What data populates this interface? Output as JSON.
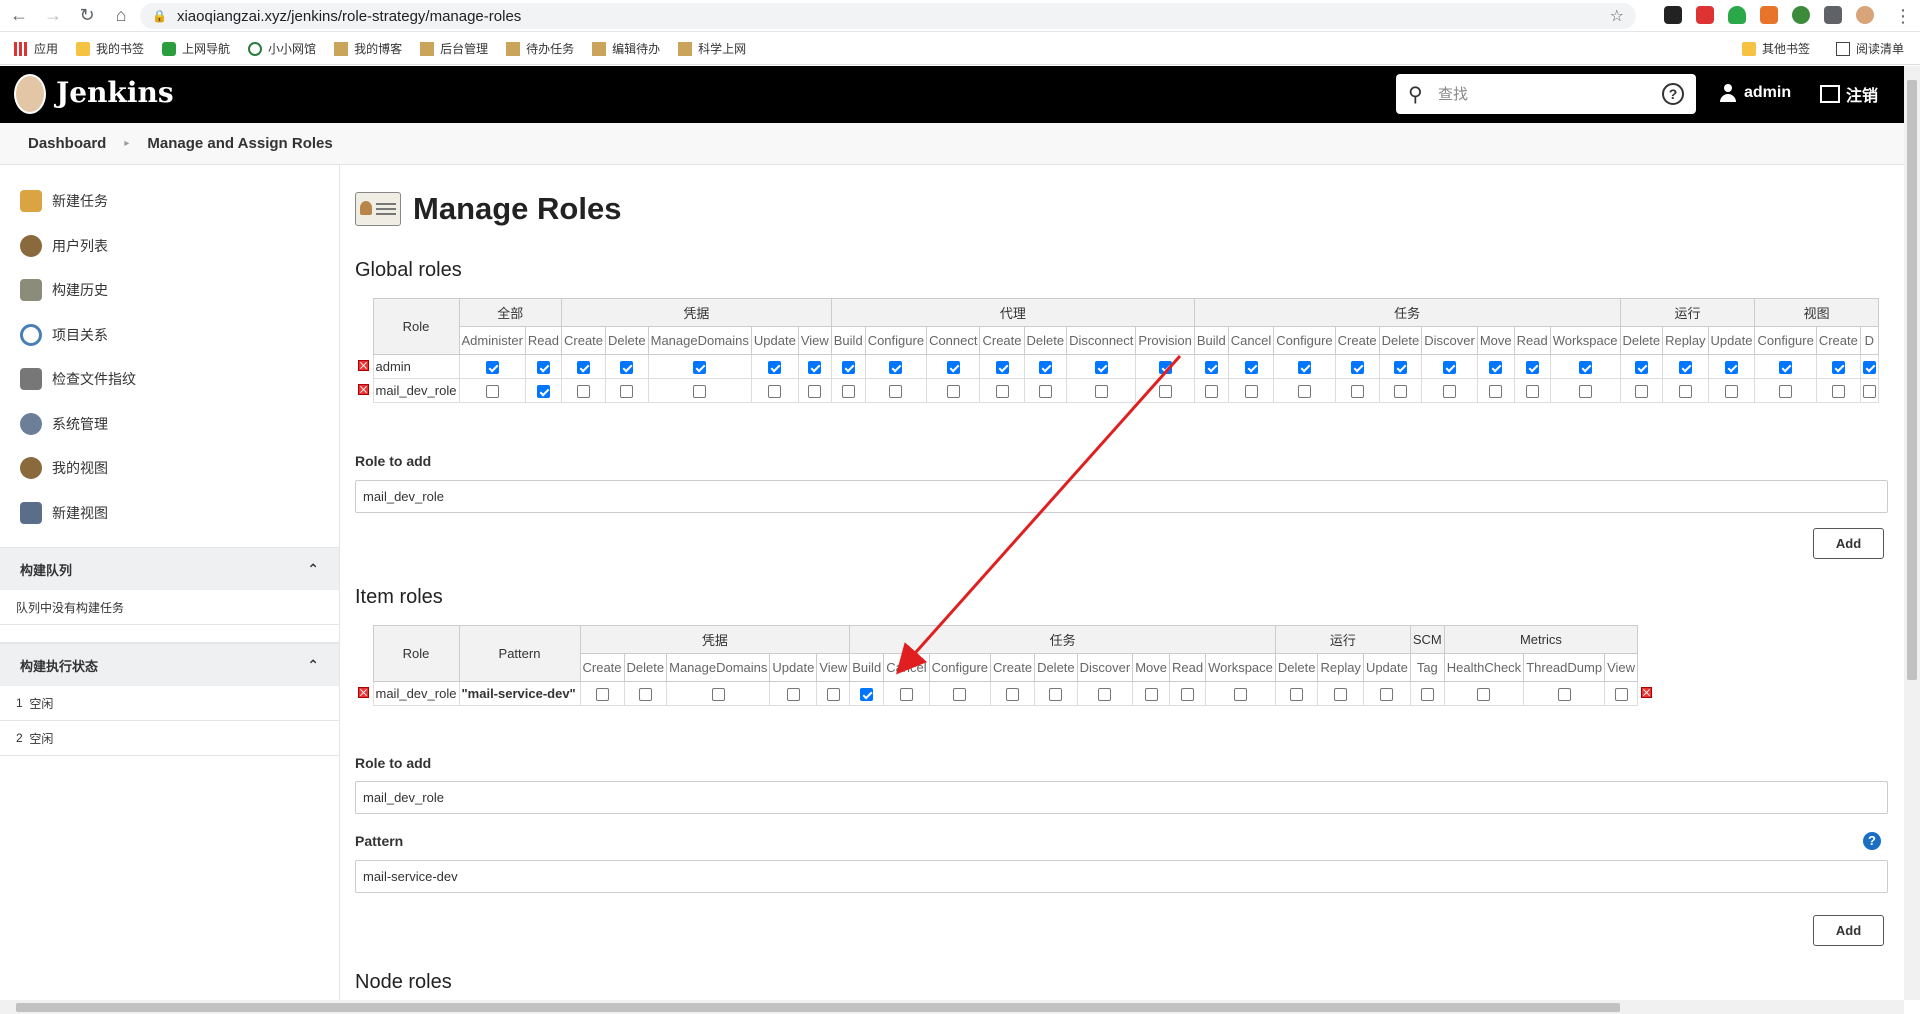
{
  "browser": {
    "url": "xiaoqiangzai.xyz/jenkins/role-strategy/manage-roles",
    "bookmarks": [
      "应用",
      "我的书签",
      "上网导航",
      "小小网馆",
      "我的博客",
      "后台管理",
      "待办任务",
      "编辑待办",
      "科学上网"
    ],
    "bookmarks_right": [
      "其他书签",
      "阅读清单"
    ]
  },
  "header": {
    "title": "Jenkins",
    "search_placeholder": "查找",
    "help": "?",
    "user": "admin",
    "logout": "注销"
  },
  "breadcrumb": [
    "Dashboard",
    "Manage and Assign Roles"
  ],
  "sidebar": {
    "items": [
      {
        "label": "新建任务",
        "icon": "new-item-icon",
        "color": "#d9a441"
      },
      {
        "label": "用户列表",
        "icon": "people-icon",
        "color": "#8a6a3c"
      },
      {
        "label": "构建历史",
        "icon": "notepad-icon",
        "color": "#8c8c7a"
      },
      {
        "label": "项目关系",
        "icon": "magnifier-icon",
        "color": "#4a7fb5"
      },
      {
        "label": "检查文件指纹",
        "icon": "fingerprint-icon",
        "color": "#777777"
      },
      {
        "label": "系统管理",
        "icon": "gear-icon",
        "color": "#6b7f99"
      },
      {
        "label": "我的视图",
        "icon": "user-view-icon",
        "color": "#8a6a3c"
      },
      {
        "label": "新建视图",
        "icon": "folder-icon",
        "color": "#5a6e8a"
      }
    ],
    "queue": {
      "title": "构建队列",
      "empty": "队列中没有构建任务"
    },
    "executors": {
      "title": "构建执行状态",
      "rows": [
        {
          "num": "1",
          "status": "空闲"
        },
        {
          "num": "2",
          "status": "空闲"
        }
      ]
    }
  },
  "main": {
    "title": "Manage Roles",
    "global": {
      "title": "Global roles",
      "role_header": "Role",
      "groups": [
        {
          "name": "全部",
          "perms": [
            "Administer",
            "Read"
          ]
        },
        {
          "name": "凭据",
          "perms": [
            "Create",
            "Delete",
            "ManageDomains",
            "Update",
            "View"
          ]
        },
        {
          "name": "代理",
          "perms": [
            "Build",
            "Configure",
            "Connect",
            "Create",
            "Delete",
            "Disconnect",
            "Provision"
          ]
        },
        {
          "name": "任务",
          "perms": [
            "Build",
            "Cancel",
            "Configure",
            "Create",
            "Delete",
            "Discover",
            "Move",
            "Read",
            "Workspace"
          ]
        },
        {
          "name": "运行",
          "perms": [
            "Delete",
            "Replay",
            "Update"
          ]
        },
        {
          "name": "视图",
          "perms": [
            "Configure",
            "Create",
            "D"
          ]
        }
      ],
      "rows": [
        {
          "name": "admin",
          "checks": [
            1,
            1,
            1,
            1,
            1,
            1,
            1,
            1,
            1,
            1,
            1,
            1,
            1,
            1,
            1,
            1,
            1,
            1,
            1,
            1,
            1,
            1,
            1,
            1,
            1,
            1,
            1,
            1,
            1
          ]
        },
        {
          "name": "mail_dev_role",
          "checks": [
            0,
            1,
            0,
            0,
            0,
            0,
            0,
            0,
            0,
            0,
            0,
            0,
            0,
            0,
            0,
            0,
            0,
            0,
            0,
            0,
            0,
            0,
            0,
            0,
            0,
            0,
            0,
            0,
            0
          ]
        }
      ],
      "role_to_add_label": "Role to add",
      "role_to_add_value": "mail_dev_role",
      "add_label": "Add"
    },
    "item": {
      "title": "Item roles",
      "role_header": "Role",
      "pattern_header": "Pattern",
      "groups": [
        {
          "name": "凭据",
          "perms": [
            "Create",
            "Delete",
            "ManageDomains",
            "Update",
            "View"
          ]
        },
        {
          "name": "任务",
          "perms": [
            "Build",
            "Cancel",
            "Configure",
            "Create",
            "Delete",
            "Discover",
            "Move",
            "Read",
            "Workspace"
          ]
        },
        {
          "name": "运行",
          "perms": [
            "Delete",
            "Replay",
            "Update"
          ]
        },
        {
          "name": "SCM",
          "perms": [
            "Tag"
          ]
        },
        {
          "name": "Metrics",
          "perms": [
            "HealthCheck",
            "ThreadDump",
            "View"
          ]
        }
      ],
      "rows": [
        {
          "name": "mail_dev_role",
          "pattern": "\"mail-service-dev\"",
          "checks": [
            0,
            0,
            0,
            0,
            0,
            1,
            0,
            0,
            0,
            0,
            0,
            0,
            0,
            0,
            0,
            0,
            0,
            0,
            0,
            0,
            0
          ]
        }
      ],
      "role_to_add_label": "Role to add",
      "role_to_add_value": "mail_dev_role",
      "pattern_label": "Pattern",
      "pattern_value": "mail-service-dev",
      "add_label": "Add"
    },
    "node": {
      "title": "Node roles"
    }
  },
  "colors": {
    "header_bg": "#000000",
    "checkbox": "#0075ff",
    "annotation_arrow": "#e02020",
    "pattern_link": "#1b5ca8"
  }
}
